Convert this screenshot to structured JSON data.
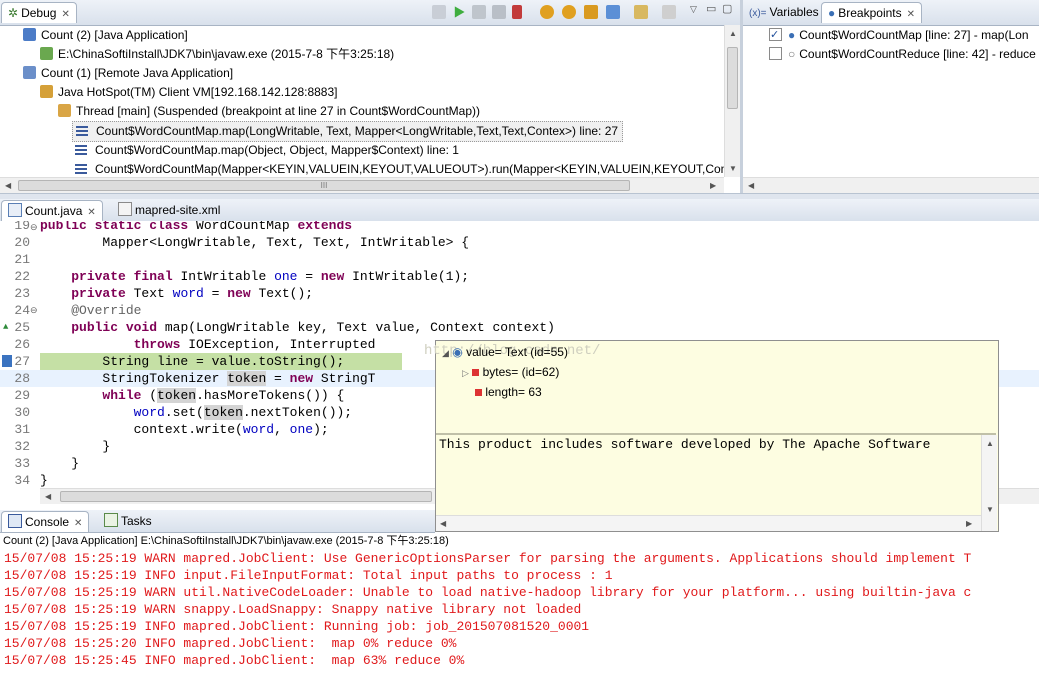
{
  "debug_view": {
    "tab_label": "Debug",
    "tree": [
      {
        "label": "Count (2) [Java Application]",
        "icon": "java-app-icon"
      },
      {
        "label": "E:\\ChinaSoftiInstall\\JDK7\\bin\\javaw.exe (2015-7-8 下午3:25:18)",
        "icon": "process-icon"
      },
      {
        "label": "Count (1) [Remote Java Application]",
        "icon": "remote-app-icon"
      },
      {
        "label": "Java HotSpot(TM) Client VM[192.168.142.128:8883]",
        "icon": "vm-icon"
      },
      {
        "label": "Thread [main] (Suspended (breakpoint at line 27 in Count$WordCountMap))",
        "icon": "thread-suspended-icon"
      },
      {
        "label": "Count$WordCountMap.map(LongWritable, Text, Mapper<LongWritable,Text,Text,Contex>) line: 27",
        "icon": "stack-frame-icon"
      },
      {
        "label": "Count$WordCountMap.map(Object, Object, Mapper$Context) line: 1",
        "icon": "stack-frame-icon"
      },
      {
        "label": "Count$WordCountMap(Mapper<KEYIN,VALUEIN,KEYOUT,VALUEOUT>).run(Mapper<KEYIN,VALUEIN,KEYOUT,Cont",
        "icon": "stack-frame-icon"
      }
    ],
    "scroll_mark": "III"
  },
  "right_view": {
    "tabs": [
      {
        "label": "Variables",
        "icon": "variables-icon"
      },
      {
        "label": "Breakpoints",
        "icon": "breakpoints-icon"
      }
    ],
    "breakpoints": [
      {
        "label": "Count$WordCountMap [line: 27] - map(Lon",
        "checked": true
      },
      {
        "label": "Count$WordCountReduce [line: 42] - reduce",
        "checked": false
      }
    ]
  },
  "editor": {
    "tabs": [
      {
        "label": "Count.java",
        "icon": "java-file-icon"
      },
      {
        "label": "mapred-site.xml",
        "icon": "xml-file-icon"
      }
    ],
    "lines": [
      {
        "num": "19",
        "text": "public static class WordCountMap extends"
      },
      {
        "num": "20",
        "text": "        Mapper<LongWritable, Text, Text, IntWritable> {"
      },
      {
        "num": "21",
        "text": ""
      },
      {
        "num": "22",
        "text": "    private final IntWritable one = new IntWritable(1);"
      },
      {
        "num": "23",
        "text": "    private Text word = new Text();"
      },
      {
        "num": "24",
        "text": "    @Override"
      },
      {
        "num": "25",
        "text": "    public void map(LongWritable key, Text value, Context context)"
      },
      {
        "num": "26",
        "text": "            throws IOException, Interrupted"
      },
      {
        "num": "27",
        "text": "        String line = value.toString();"
      },
      {
        "num": "28",
        "text": "        StringTokenizer token = new StringT"
      },
      {
        "num": "29",
        "text": "        while (token.hasMoreTokens()) {"
      },
      {
        "num": "30",
        "text": "            word.set(token.nextToken());"
      },
      {
        "num": "31",
        "text": "            context.write(word, one);"
      },
      {
        "num": "32",
        "text": "        }"
      },
      {
        "num": "33",
        "text": "    }"
      },
      {
        "num": "34",
        "text": "}"
      }
    ]
  },
  "hover": {
    "root": "value= Text  (id=55)",
    "children": [
      "bytes=  (id=62)",
      "length= 63"
    ],
    "detail": "This product includes software developed by The Apache Software",
    "watermark": "http://blog.csdn.net/"
  },
  "console": {
    "tabs": [
      {
        "label": "Console",
        "icon": "console-icon"
      },
      {
        "label": "Tasks",
        "icon": "tasks-icon"
      }
    ],
    "process": "Count (2) [Java Application] E:\\ChinaSoftiInstall\\JDK7\\bin\\javaw.exe (2015-7-8 下午3:25:18)",
    "lines": [
      "15/07/08 15:25:19 WARN mapred.JobClient: Use GenericOptionsParser for parsing the arguments. Applications should implement T",
      "15/07/08 15:25:19 INFO input.FileInputFormat: Total input paths to process : 1",
      "15/07/08 15:25:19 WARN util.NativeCodeLoader: Unable to load native-hadoop library for your platform... using builtin-java c",
      "15/07/08 15:25:19 WARN snappy.LoadSnappy: Snappy native library not loaded",
      "15/07/08 15:25:19 INFO mapred.JobClient: Running job: job_201507081520_0001",
      "15/07/08 15:25:20 INFO mapred.JobClient:  map 0% reduce 0%",
      "15/07/08 15:25:45 INFO mapred.JobClient:  map 63% reduce 0%"
    ]
  },
  "colors": {
    "keyword": "#7f0055",
    "field": "#0000c0",
    "console_text": "#e0191b",
    "current_line": "#c5e0a5",
    "hover_bg": "#fdfde1"
  }
}
